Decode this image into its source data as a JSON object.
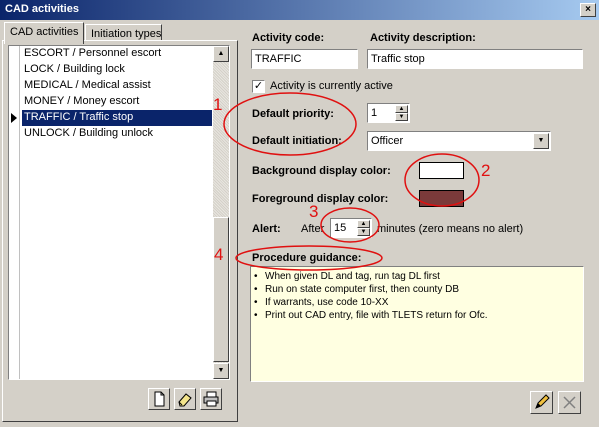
{
  "window": {
    "title": "CAD activities",
    "close_glyph": "×"
  },
  "tabs": [
    {
      "label": "CAD activities",
      "active": true
    },
    {
      "label": "Initiation types",
      "active": false
    }
  ],
  "activity_list": {
    "items": [
      {
        "label": "ESCORT / Personnel escort",
        "selected": false
      },
      {
        "label": "LOCK / Building lock",
        "selected": false
      },
      {
        "label": "MEDICAL / Medical assist",
        "selected": false
      },
      {
        "label": "MONEY / Money escort",
        "selected": false
      },
      {
        "label": "TRAFFIC / Traffic stop",
        "selected": true
      },
      {
        "label": "UNLOCK / Building unlock",
        "selected": false
      }
    ]
  },
  "list_buttons": {
    "new_icon": "new-document-icon",
    "edit_icon": "eraser-icon",
    "print_icon": "printer-icon"
  },
  "form": {
    "activity_code_label": "Activity code:",
    "activity_code_value": "TRAFFIC",
    "activity_description_label": "Activity description:",
    "activity_description_value": "Traffic stop",
    "active_checkbox_label": "Activity is currently active",
    "active_checked": true,
    "default_priority_label": "Default priority:",
    "default_priority_value": "1",
    "default_initiation_label": "Default initiation:",
    "default_initiation_value": "Officer",
    "background_color_label": "Background display color:",
    "background_color": "#ffffff",
    "foreground_color_label": "Foreground display color:",
    "foreground_color": "#7b3a3a",
    "alert_label": "Alert:",
    "alert_after_label": "After",
    "alert_value": "15",
    "alert_suffix": "minutes (zero means no alert)",
    "procedure_label": "Procedure guidance:",
    "procedure_lines": [
      "When given DL and tag, run tag DL first",
      "Run on state computer first, then county DB",
      "If warrants, use code 10-XX",
      "Print out CAD entry, file with TLETS return for Ofc."
    ],
    "bullet": "•"
  },
  "annotations": {
    "color": "#e01010",
    "labels": [
      "1",
      "2",
      "3",
      "4"
    ]
  },
  "bottom_buttons": {
    "edit_icon": "pencil-icon",
    "cancel_icon": "x-icon"
  }
}
